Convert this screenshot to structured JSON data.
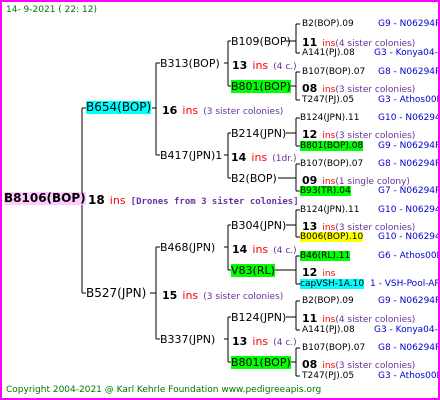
{
  "header": {
    "date": "14-  9-2021 (  22: 12)"
  },
  "footer": {
    "copyright": "Copyright 2004-2021 @ Karl Kehrle Foundation    www.pedigreeapis.org"
  },
  "root": {
    "name": "B8106(BOP)",
    "ins": "18",
    "ins_label": "ins",
    "note": "[Drones from 3 sister colonies]"
  },
  "g1": [
    {
      "name": "B654(BOP)",
      "ins": "16",
      "ins_label": "ins",
      "note": "(3 sister colonies)"
    },
    {
      "name": "B527(JPN)",
      "ins": "15",
      "ins_label": "ins",
      "note": "(3 sister colonies)"
    }
  ],
  "g2": [
    {
      "name": "B313(BOP)",
      "ins": "13",
      "ins_label": "ins",
      "note": "(4 c.)"
    },
    {
      "name": "B417(JPN)1",
      "ins": "14",
      "ins_label": "ins",
      "note": "(1dr.)"
    },
    {
      "name": "B468(JPN)",
      "ins": "14",
      "ins_label": "ins",
      "note": "(4 c.)"
    },
    {
      "name": "B337(JPN)",
      "ins": "13",
      "ins_label": "ins",
      "note": "(4 c.)"
    }
  ],
  "g3": [
    {
      "name": "B109(BOP)",
      "ins": "11",
      "ins_label": "ins",
      "note": "(4 sister colonies)"
    },
    {
      "name": "B801(BOP)",
      "ins": "08",
      "ins_label": "ins",
      "note": "(3 sister colonies)"
    },
    {
      "name": "B214(JPN)",
      "ins": "12",
      "ins_label": "ins",
      "note": "(3 sister colonies)"
    },
    {
      "name": "B2(BOP)",
      "ins": "09",
      "ins_label": "ins",
      "note": "(1 single colony)"
    },
    {
      "name": "B304(JPN)",
      "ins": "13",
      "ins_label": "ins",
      "note": "(3 sister colonies)"
    },
    {
      "name": "V83(RL)",
      "ins": "12",
      "ins_label": "ins",
      "note": ""
    },
    {
      "name": "B124(JPN)",
      "ins": "11",
      "ins_label": "ins",
      "note": "(4 sister colonies)"
    },
    {
      "name": "B801(BOP)",
      "ins": "08",
      "ins_label": "ins",
      "note": "(3 sister colonies)"
    }
  ],
  "g4": [
    {
      "name": "B2(BOP).09",
      "code": "G9 - N06294R"
    },
    {
      "name": "A141(PJ).08",
      "code": "G3 - Konya04-2"
    },
    {
      "name": "B107(BOP).07",
      "code": "G8 - N06294R"
    },
    {
      "name": "T247(PJ).05",
      "code": "G3 - Athos00R"
    },
    {
      "name": "B124(JPN).11",
      "code": "G10 - N06294R"
    },
    {
      "name": "B801(BOP).08",
      "code": "G9 - N06294R"
    },
    {
      "name": "B107(BOP).07",
      "code": "G8 - N06294R"
    },
    {
      "name": "B93(TR).04",
      "code": "G7 - N06294R"
    },
    {
      "name": "B124(JPN).11",
      "code": "G10 - N06294R"
    },
    {
      "name": "B006(BOP).10",
      "code": "G10 - N06294R"
    },
    {
      "name": "B46(RL).11",
      "code": "G6 - Athos00R"
    },
    {
      "name": "capVSH-1A.10",
      "code": "1 - VSH-Pool-AR"
    },
    {
      "name": "B2(BOP).09",
      "code": "G9 - N06294R"
    },
    {
      "name": "A141(PJ).08",
      "code": "G3 - Konya04-2"
    },
    {
      "name": "B107(BOP).07",
      "code": "G8 - N06294R"
    },
    {
      "name": "T247(PJ).05",
      "code": "G3 - Athos00R"
    }
  ],
  "colors": {
    "border": "#ff00ff",
    "root_bg": "#ffccff",
    "cyan": "#00ffff",
    "green": "#00ff00",
    "yellow": "#ffff00",
    "ins": "#ff0000",
    "note": "#663399",
    "code": "#0000cc",
    "header": "#007700"
  }
}
